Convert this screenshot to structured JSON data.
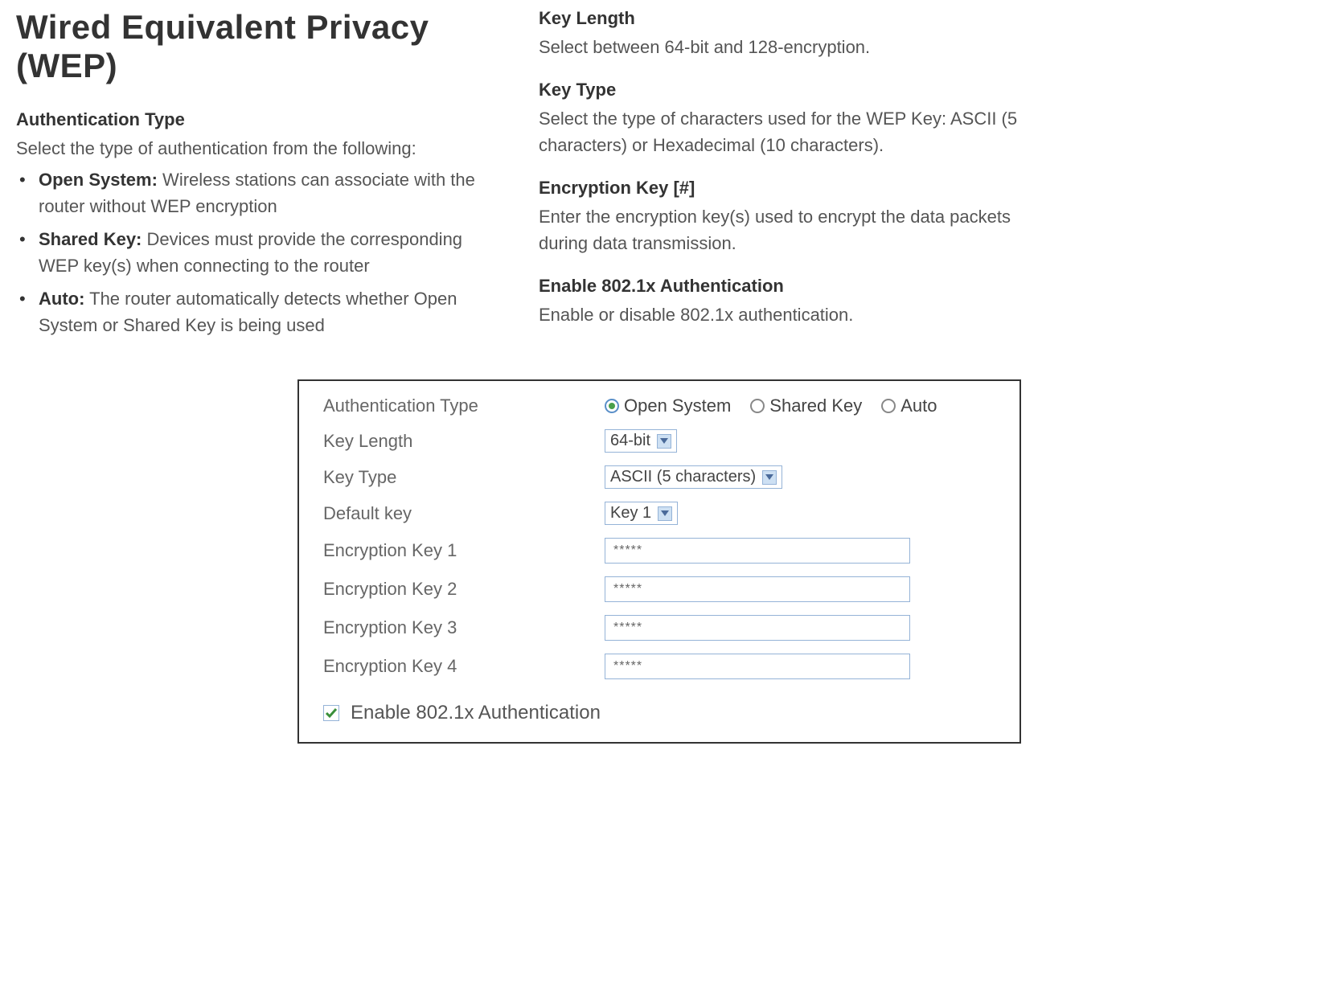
{
  "title": "Wired Equivalent Privacy (WEP)",
  "left": {
    "auth_type": {
      "heading": "Authentication Type",
      "desc": "Select the type of authentication from the following:",
      "items": [
        {
          "bold": "Open System:",
          "rest": " Wireless stations can associate with the router without WEP encryption"
        },
        {
          "bold": "Shared Key:",
          "rest": " Devices must provide the corresponding WEP key(s) when connecting to the router"
        },
        {
          "bold": "Auto:",
          "rest": " The router automatically detects whether Open System or Shared Key is being used"
        }
      ]
    }
  },
  "right": {
    "key_length": {
      "heading": "Key Length",
      "desc": "Select between 64-bit and 128-encryption."
    },
    "key_type": {
      "heading": "Key Type",
      "desc": "Select the type of characters used for the WEP Key: ASCII (5 characters) or Hexadecimal (10 characters)."
    },
    "enc_key": {
      "heading": "Encryption Key [#]",
      "desc": "Enter the encryption key(s) used to encrypt the data packets during data transmission."
    },
    "enable_8021x": {
      "heading": "Enable 802.1x Authentication",
      "desc": "Enable or disable 802.1x authentication."
    }
  },
  "form": {
    "auth_type_label": "Authentication Type",
    "radios": {
      "open": "Open System",
      "shared": "Shared Key",
      "auto": "Auto",
      "selected": "open"
    },
    "key_length": {
      "label": "Key Length",
      "value": "64-bit"
    },
    "key_type": {
      "label": "Key Type",
      "value": "ASCII (5 characters)"
    },
    "default_key": {
      "label": "Default key",
      "value": "Key 1"
    },
    "enc1": {
      "label": "Encryption Key 1",
      "value": "*****"
    },
    "enc2": {
      "label": "Encryption Key 2",
      "value": "*****"
    },
    "enc3": {
      "label": "Encryption Key 3",
      "value": "*****"
    },
    "enc4": {
      "label": "Encryption Key 4",
      "value": "*****"
    },
    "enable_8021x": {
      "label": "Enable 802.1x Authentication",
      "checked": true
    }
  }
}
